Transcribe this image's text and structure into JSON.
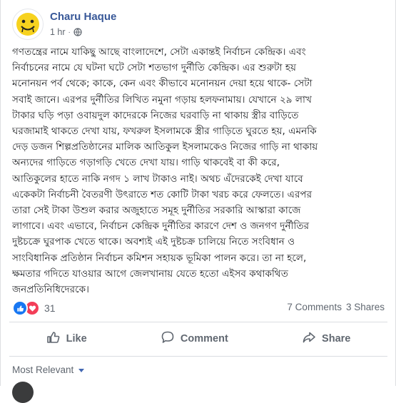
{
  "post": {
    "author": "Charu Haque",
    "timestamp": "1 hr",
    "separator": "·",
    "privacy_icon": "globe-icon",
    "avatar_icon": "smiley-avatar-icon",
    "lines": [
      "গণতন্ত্রের নামে যাকিছু আছে বাংলাদেশে, সেটা একান্তই নির্বাচন কেন্দ্রিক। এবং",
      "নির্বাচনের নামে যে ঘটনা ঘটে সেটা শতভাগ দুর্নীতি কেন্দ্রিক। এর শুরুটা হয়",
      "মনোনয়ন পর্ব থেকে; কাকে, কেন এবং কীভাবে মনোনয়ন দেয়া হয়ে থাকে- সেটা",
      "সবাই জানে। এরপর দুর্নীতির লিখিত নমুনা গড়ায় হলফনামায়। যেখানে ২৯ লাখ",
      "টাকার ঘড়ি পড়া ওবায়দুল কাদেরকে নিজের ঘরবাড়ি না থাকায় স্ত্রীর বাড়িতে",
      "ঘরজামাই থাকতে দেখা যায়, ফখরুল ইসলামকে স্ত্রীর গাড়িতে ঘুরতে হয়, এমনকি",
      "দেড় ডজন শিল্পপ্রতিষ্ঠানের মালিক আতিকুল ইসলামকেও নিজের গাড়ি না থাকায়",
      "অন্যদের গাড়িতে গড়াগড়ি খেতে দেখা যায়। গাড়ি থাকবেই বা কী করে,",
      "আতিকুলের হাতে নাকি নগদ ১ লাখ টাকাও নাই। অথচ এঁদেরকেই দেখা যাবে",
      "একেকটা নির্বাচনী বৈতরণী উৎরাতে শত কোটি টাকা খরচ করে ফেলতে। এরপর",
      "তারা সেই টাকা উশুল করার অজুহাতে সমূহ দুর্নীতির সরকারি আস্কারা কাজে",
      "লাগাবে। এবং এভাবে, নির্বাচন কেন্দ্রিক দুর্নীতির কারণে দেশ ও জনগণ দুর্নীতির",
      "দুষ্টচক্রে ঘুরপাক খেতে থাকে। অবশ্যই এই দুষ্টচক্র চালিয়ে নিতে সংবিধান ও",
      "সাংবিধানিক প্রতিষ্ঠান নির্বাচন কমিশন সহায়ক ভূমিকা পালন করে। তা না হলে,",
      "ক্ষমতার গদিতে যাওয়ার আগে জেলখানায় যেতে হতো এইসব কথাকথিত",
      "জনপ্রতিনিধিদেরকে।"
    ]
  },
  "stats": {
    "reaction_icons": [
      "like-reaction-icon",
      "love-reaction-icon"
    ],
    "reaction_count": "31",
    "comments": "7 Comments",
    "shares": "3 Shares"
  },
  "actions": {
    "like": "Like",
    "comment": "Comment",
    "share": "Share"
  },
  "comments_filter": {
    "label": "Most Relevant"
  },
  "colors": {
    "author": "#385898",
    "like_blue": "#1877f2",
    "love_red": "#f33e58",
    "muted": "#606770"
  }
}
